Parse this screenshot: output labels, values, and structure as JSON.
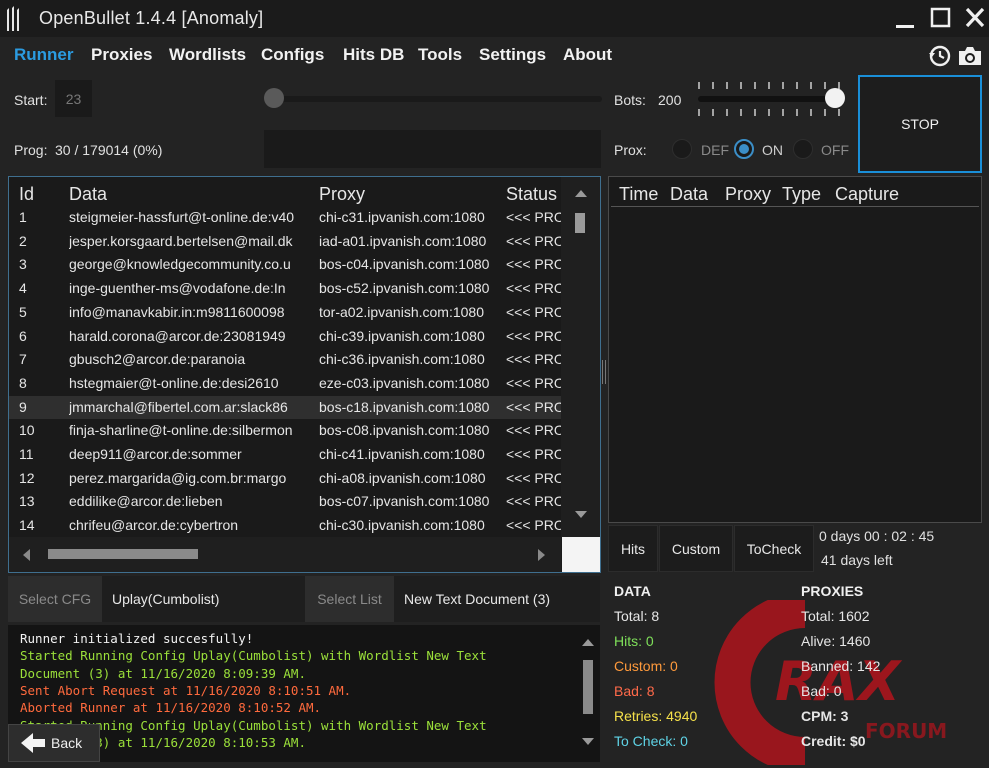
{
  "window": {
    "title": "OpenBullet 1.4.4 [Anomaly]",
    "accent_color": "#2b9be0"
  },
  "menu": {
    "items": [
      {
        "label": "Runner",
        "active": true
      },
      {
        "label": "Proxies"
      },
      {
        "label": "Wordlists"
      },
      {
        "label": "Configs"
      },
      {
        "label": "Hits DB"
      },
      {
        "label": "Tools"
      },
      {
        "label": "Settings"
      },
      {
        "label": "About"
      }
    ],
    "icons": [
      "history-icon",
      "camera-icon"
    ]
  },
  "runner": {
    "start_label": "Start:",
    "start_value": "23",
    "start_slider_fraction": 0.0,
    "bots_label": "Bots:",
    "bots_value": "200",
    "bots_slider_fraction": 1.0,
    "prog_label": "Prog:",
    "prog_value": "30 / 179014 (0%)",
    "prox_label": "Prox:",
    "prox_options": [
      {
        "label": "DEF",
        "checked": false
      },
      {
        "label": "ON",
        "checked": true
      },
      {
        "label": "OFF",
        "checked": false
      }
    ],
    "stop_label": "STOP"
  },
  "grid": {
    "headers": [
      "Id",
      "Data",
      "Proxy",
      "Status"
    ],
    "rows": [
      {
        "id": "1",
        "data": "steigmeier-hassfurt@t-online.de:v40",
        "proxy": "chi-c31.ipvanish.com:1080",
        "status": "<<< PRO"
      },
      {
        "id": "2",
        "data": "jesper.korsgaard.bertelsen@mail.dk",
        "proxy": "iad-a01.ipvanish.com:1080",
        "status": "<<< PRO"
      },
      {
        "id": "3",
        "data": "george@knowledgecommunity.co.u",
        "proxy": "bos-c04.ipvanish.com:1080",
        "status": "<<< PRO"
      },
      {
        "id": "4",
        "data": "inge-guenther-ms@vodafone.de:In",
        "proxy": "bos-c52.ipvanish.com:1080",
        "status": "<<< PRO"
      },
      {
        "id": "5",
        "data": "info@manavkabir.in:m9811600098",
        "proxy": "tor-a02.ipvanish.com:1080",
        "status": "<<< PRO"
      },
      {
        "id": "6",
        "data": "harald.corona@arcor.de:23081949",
        "proxy": "chi-c39.ipvanish.com:1080",
        "status": "<<< PRO"
      },
      {
        "id": "7",
        "data": "gbusch2@arcor.de:paranoia",
        "proxy": "chi-c36.ipvanish.com:1080",
        "status": "<<< PRO"
      },
      {
        "id": "8",
        "data": "hstegmaier@t-online.de:desi2610",
        "proxy": "eze-c03.ipvanish.com:1080",
        "status": "<<< PRO"
      },
      {
        "id": "9",
        "data": "jmmarchal@fibertel.com.ar:slack86",
        "proxy": "bos-c18.ipvanish.com:1080",
        "status": "<<< PRO",
        "selected": true
      },
      {
        "id": "10",
        "data": "finja-sharline@t-online.de:silbermon",
        "proxy": "bos-c08.ipvanish.com:1080",
        "status": "<<< PRO"
      },
      {
        "id": "11",
        "data": "deep911@arcor.de:sommer",
        "proxy": "chi-c41.ipvanish.com:1080",
        "status": "<<< PRO"
      },
      {
        "id": "12",
        "data": "perez.margarida@ig.com.br:margo",
        "proxy": "chi-a08.ipvanish.com:1080",
        "status": "<<< PRO"
      },
      {
        "id": "13",
        "data": "eddilike@arcor.de:lieben",
        "proxy": "bos-c07.ipvanish.com:1080",
        "status": "<<< PRO"
      },
      {
        "id": "14",
        "data": "chrifeu@arcor.de:cybertron",
        "proxy": "chi-c30.ipvanish.com:1080",
        "status": "<<< PRO"
      }
    ]
  },
  "hits": {
    "headers": [
      "Time",
      "Data",
      "Proxy",
      "Type",
      "Capture"
    ],
    "tabs": [
      "Hits",
      "Custom",
      "ToCheck"
    ],
    "elapsed": "0 days 00 : 02 : 45",
    "remaining": "41 days left"
  },
  "selectors": {
    "cfg_button": "Select CFG",
    "cfg_value": "Uplay(Cumbolist)",
    "list_button": "Select List",
    "list_value": "New Text Document (3)"
  },
  "log": {
    "lines": [
      {
        "text": "Runner initialized succesfully!",
        "color": "#f2f2f2"
      },
      {
        "text": "Started Running Config Uplay(Cumbolist) with Wordlist New Text",
        "color": "#9be03a"
      },
      {
        "text": "Document (3) at 11/16/2020 8:09:39 AM.",
        "color": "#9be03a"
      },
      {
        "text": "Sent Abort Request at 11/16/2020 8:10:51 AM.",
        "color": "#ff6a3d"
      },
      {
        "text": "Aborted Runner at 11/16/2020 8:10:52 AM.",
        "color": "#ff6a3d"
      },
      {
        "text": "Started Running Config Uplay(Cumbolist) with Wordlist New Text",
        "color": "#9be03a"
      },
      {
        "text": "Document (3) at 11/16/2020 8:10:53 AM.",
        "color": "#9be03a"
      }
    ]
  },
  "back_label": "Back",
  "stats": {
    "data_heading": "DATA",
    "total": "Total:  8",
    "hits": "Hits:  0",
    "custom": "Custom:  0",
    "bad": "Bad:  8",
    "retries": "Retries:  4940",
    "tocheck": "To Check:  0",
    "proxies_heading": "PROXIES",
    "p_total": "Total:  1602",
    "p_alive": "Alive:  1460",
    "p_banned": "Banned:  142",
    "p_bad": "Bad:  0",
    "cpm": "CPM:  3",
    "credit": "Credit:  $0"
  },
  "colors": {
    "hits": "#7fe05a",
    "custom": "#ff9a3c",
    "bad": "#ff6a4a",
    "retries": "#f6e14a",
    "tocheck": "#5fd3e6"
  },
  "watermark": {
    "brand": "RAX",
    "sub": "FORUM"
  }
}
